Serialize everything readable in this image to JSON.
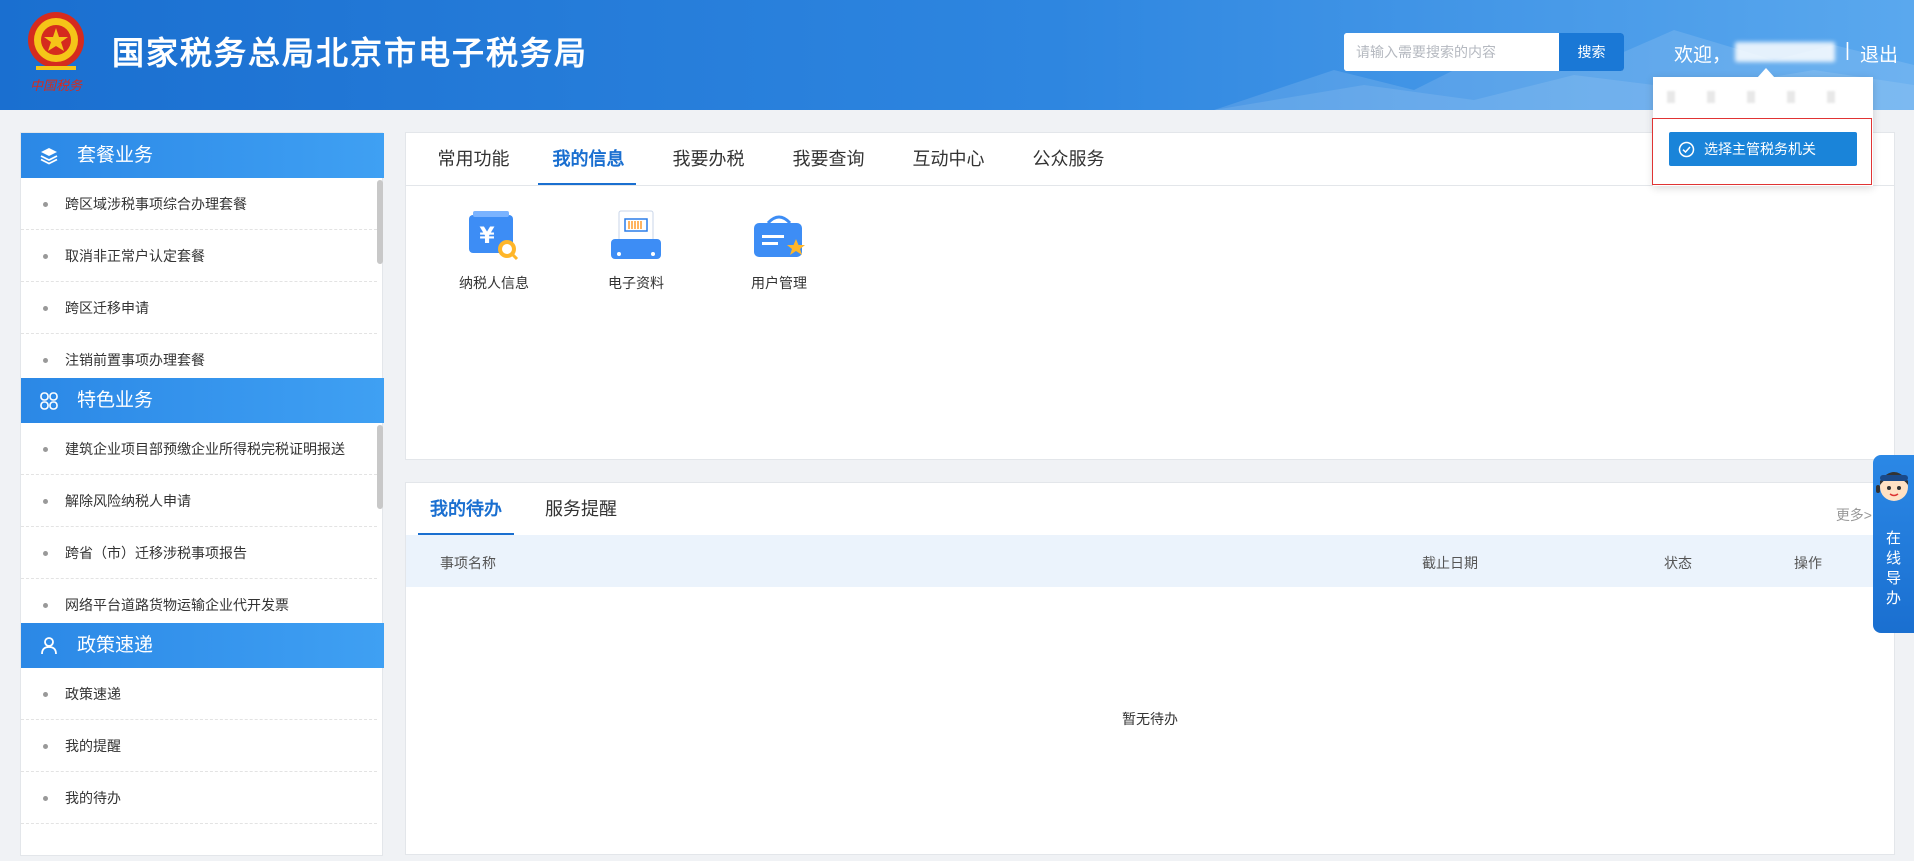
{
  "header": {
    "site_title": "国家税务总局北京市电子税务局",
    "emblem_text": "中国税务",
    "search_placeholder": "请输入需要搜索的内容",
    "search_button": "搜索",
    "welcome": "欢迎，",
    "separator": "|",
    "logout": "退出"
  },
  "dropdown": {
    "select_org_button": "选择主管税务机关"
  },
  "sidebar": {
    "sections": [
      {
        "title": "套餐业务",
        "icon": "layers-icon",
        "items": [
          "跨区域涉税事项综合办理套餐",
          "取消非正常户认定套餐",
          "跨区迁移申请",
          "注销前置事项办理套餐"
        ]
      },
      {
        "title": "特色业务",
        "icon": "grid-icon",
        "items": [
          "建筑企业项目部预缴企业所得税完税证明报送",
          "解除风险纳税人申请",
          "跨省（市）迁移涉税事项报告",
          "网络平台道路货物运输企业代开发票"
        ]
      },
      {
        "title": "政策速递",
        "icon": "user-icon",
        "items": [
          "政策速递",
          "我的提醒",
          "我的待办"
        ]
      }
    ]
  },
  "main_tabs": {
    "tabs": [
      "常用功能",
      "我的信息",
      "我要办税",
      "我要查询",
      "互动中心",
      "公众服务"
    ],
    "active": "我的信息"
  },
  "functions": [
    {
      "label": "纳税人信息",
      "icon": "taxpayer-info-icon"
    },
    {
      "label": "电子资料",
      "icon": "electronic-docs-icon"
    },
    {
      "label": "用户管理",
      "icon": "user-management-icon"
    }
  ],
  "todo": {
    "tabs": [
      "我的待办",
      "服务提醒"
    ],
    "active": "我的待办",
    "more": "更多>",
    "columns": [
      "事项名称",
      "截止日期",
      "状态",
      "操作"
    ],
    "empty_text": "暂无待办"
  },
  "online_guide": {
    "label": "在线导办"
  },
  "colors": {
    "primary": "#1a6fd0",
    "header_gradient_start": "#1a6fd0",
    "header_gradient_end": "#5aa8ee",
    "highlight_border": "#e03434"
  }
}
